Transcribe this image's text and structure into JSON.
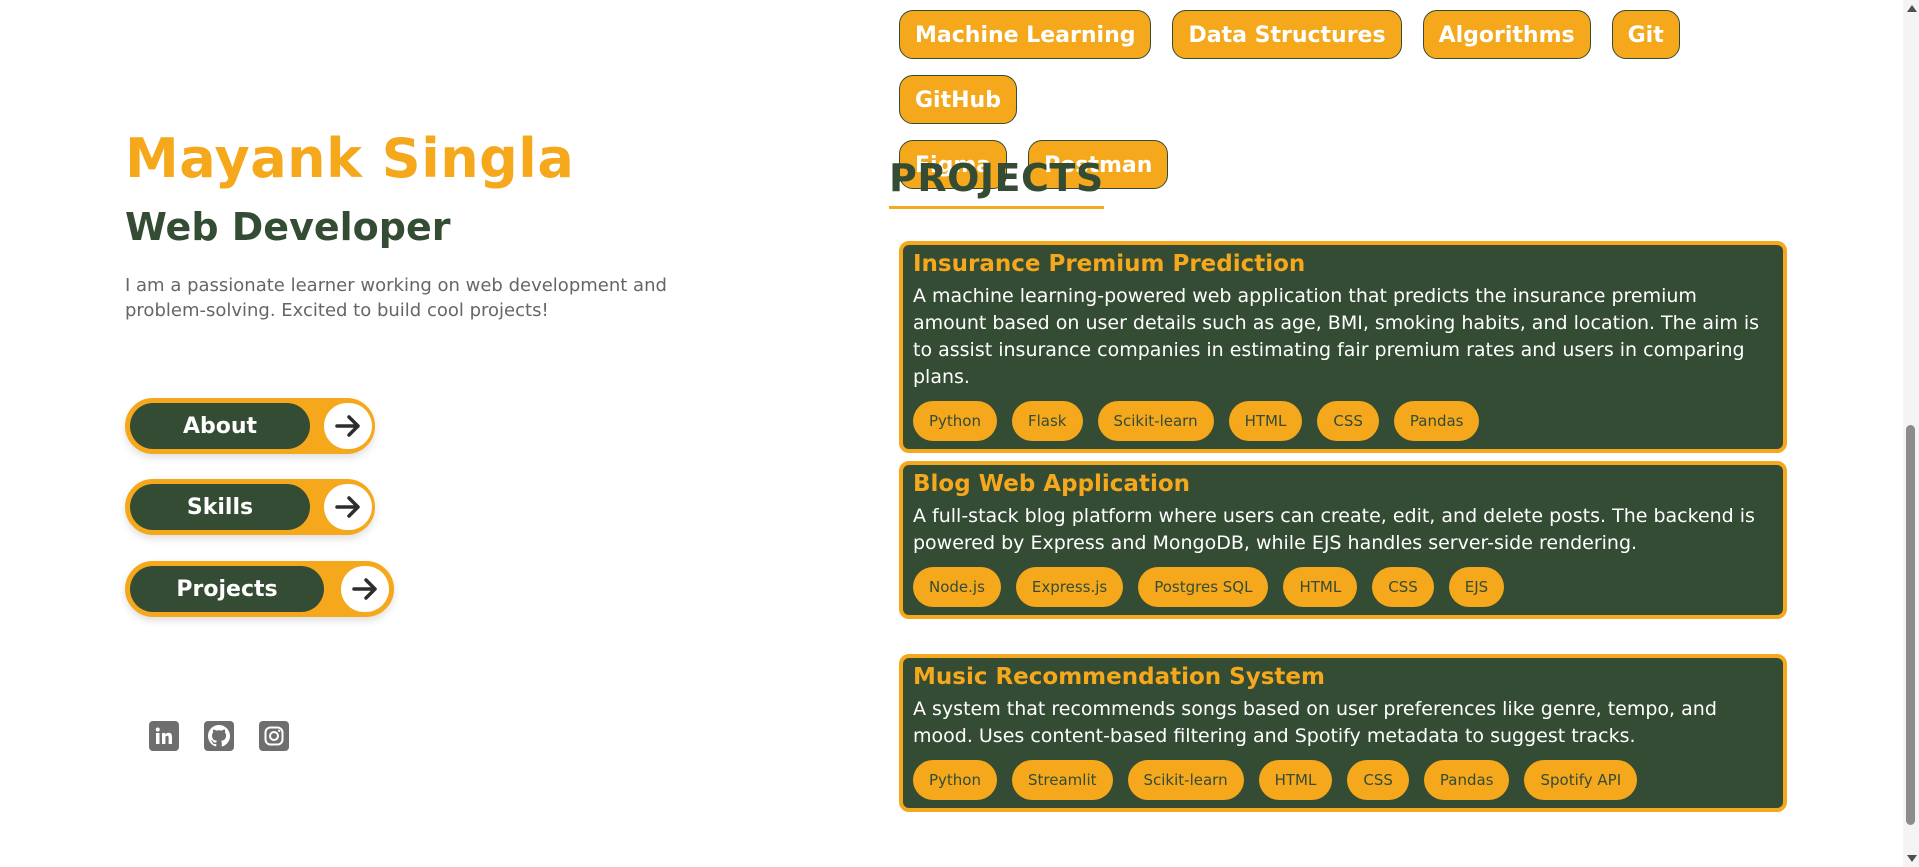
{
  "profile": {
    "name": "Mayank Singla",
    "role": "Web Developer",
    "bio": "I am a passionate learner working on web development and problem-solving. Excited to build cool projects!"
  },
  "nav": {
    "about": "About",
    "skills": "Skills",
    "projects": "Projects"
  },
  "social": {
    "linkedin": "linkedin-icon",
    "github": "github-icon",
    "instagram": "instagram-icon"
  },
  "skills": [
    "Machine Learning",
    "Data Structures",
    "Algorithms",
    "Git",
    "GitHub",
    "Figma",
    "Postman"
  ],
  "projects_title": "PROJECTS",
  "projects": [
    {
      "title": "Insurance Premium Prediction",
      "description": "A machine learning-powered web application that predicts the insurance premium amount based on user details such as age, BMI, smoking habits, and location. The aim is to assist insurance companies in estimating fair premium rates and users in comparing plans.",
      "tags": [
        "Python",
        "Flask",
        "Scikit-learn",
        "HTML",
        "CSS",
        "Pandas"
      ]
    },
    {
      "title": "Blog Web Application",
      "description": "A full-stack blog platform where users can create, edit, and delete posts. The backend is powered by Express and MongoDB, while EJS handles server-side rendering.",
      "tags": [
        "Node.js",
        "Express.js",
        "Postgres SQL",
        "HTML",
        "CSS",
        "EJS"
      ]
    },
    {
      "title": "Music Recommendation System",
      "description": "A system that recommends songs based on user preferences like genre, tempo, and mood. Uses content-based filtering and Spotify metadata to suggest tracks.",
      "tags": [
        "Python",
        "Streamlit",
        "Scikit-learn",
        "HTML",
        "CSS",
        "Pandas",
        "Spotify API"
      ]
    }
  ],
  "colors": {
    "accent": "#f5a81c",
    "dark_green": "#344c34",
    "text_gray": "#666666",
    "background": "#ffffff"
  }
}
